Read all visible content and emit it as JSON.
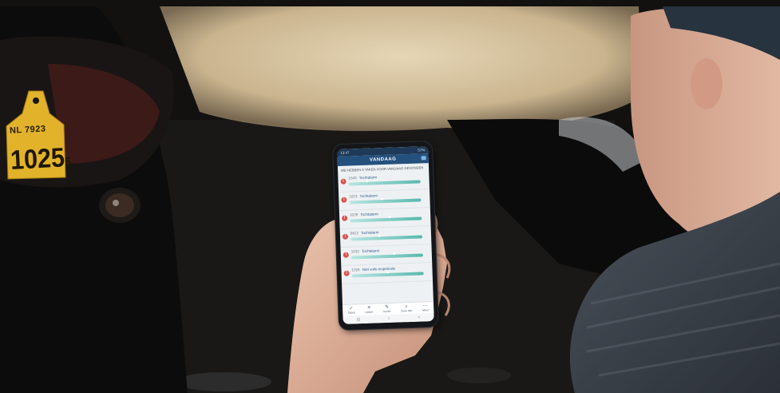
{
  "scene": {
    "description_colors": {
      "background": "#121110",
      "cow_hide": "#d9c7a4",
      "shirt": "#3a4048",
      "cap": "#27333f"
    }
  },
  "ear_tag": {
    "line1": "NL 7923",
    "line2": "",
    "number_main": "1025",
    "number_suffix": "5"
  },
  "phone": {
    "status_left": "13:47",
    "status_right": "57%",
    "header_title": "VANDAAG",
    "intro_text": "WE HEBBEN 6 TAKEN VOOR VANDAAG GEVONDEN",
    "alerts": [
      {
        "number": "1543",
        "label": "Tochtalarm",
        "marker": 0.25,
        "icon": "!"
      },
      {
        "number": "1023",
        "label": "Tochtalarm",
        "marker": 0.45,
        "icon": "!"
      },
      {
        "number": "1028",
        "label": "Tochtalarm",
        "marker": 0.55,
        "icon": "!"
      },
      {
        "number": "9812",
        "label": "Tochtalarm",
        "marker": 0.4,
        "icon": "!"
      },
      {
        "number": "1032",
        "label": "Tochtalarm",
        "marker": 0.6,
        "icon": "!"
      },
      {
        "number": "1026",
        "label": "Niet volle insperiode",
        "marker": 0.5,
        "icon": "!"
      }
    ],
    "nav": [
      {
        "label": "Taken",
        "icon": "tasks-icon",
        "glyph": "✓"
      },
      {
        "label": "Lijsten",
        "icon": "list-icon",
        "glyph": "≡"
      },
      {
        "label": "Invoer",
        "icon": "pencil-icon",
        "glyph": "✎"
      },
      {
        "label": "Zoek dier",
        "icon": "search-icon",
        "glyph": "⌕"
      },
      {
        "label": "Meer",
        "icon": "more-icon",
        "glyph": "⋯"
      }
    ],
    "system_nav": [
      "|||",
      "○",
      "<"
    ],
    "accent": "#24507e",
    "alert_color": "#d9534f"
  }
}
